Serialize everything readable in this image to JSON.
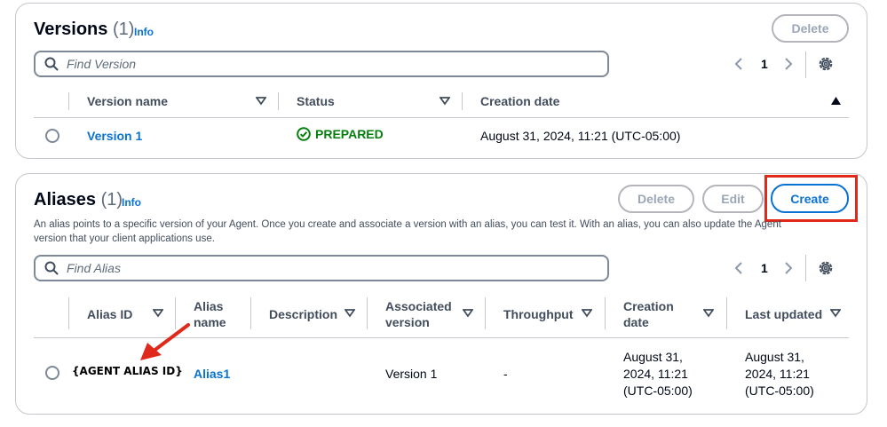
{
  "versions": {
    "title": "Versions",
    "count": "(1)",
    "info": "Info",
    "delete_label": "Delete",
    "search_placeholder": "Find Version",
    "page": "1",
    "columns": [
      "Version name",
      "Status",
      "Creation date"
    ],
    "rows": [
      {
        "name": "Version 1",
        "status": "PREPARED",
        "created": "August 31, 2024, 11:21 (UTC-05:00)"
      }
    ]
  },
  "aliases": {
    "title": "Aliases",
    "count": "(1)",
    "info": "Info",
    "delete_label": "Delete",
    "edit_label": "Edit",
    "create_label": "Create",
    "description_line1": "An alias points to a specific version of your Agent. Once you create and associate a version with an alias, you can test it. With an alias, you can also update the Agent",
    "description_line2": "version that your client applications use.",
    "search_placeholder": "Find Alias",
    "page": "1",
    "columns": {
      "alias_id": "Alias ID",
      "alias_name_1": "Alias",
      "alias_name_2": "name",
      "description": "Description",
      "assoc_1": "Associated",
      "assoc_2": "version",
      "throughput": "Throughput",
      "creation_1": "Creation",
      "creation_2": "date",
      "last_updated": "Last updated"
    },
    "rows": [
      {
        "alias_id": "{AGENT ALIAS ID}",
        "alias_name": "Alias1",
        "associated_version": "Version 1",
        "throughput": "-",
        "creation_1": "August 31,",
        "creation_2": "2024, 11:21",
        "creation_3": "(UTC-05:00)",
        "updated_1": "August 31,",
        "updated_2": "2024, 11:21",
        "updated_3": "(UTC-05:00)"
      }
    ]
  },
  "colors": {
    "link": "#0972d3",
    "success": "#037f0c",
    "annotation": "#e0291b"
  },
  "icons": [
    "search-icon",
    "chevron-left-icon",
    "chevron-right-icon",
    "gear-icon",
    "check-circle-icon",
    "sort-down-icon",
    "sort-up-icon",
    "arrow-annotation"
  ]
}
